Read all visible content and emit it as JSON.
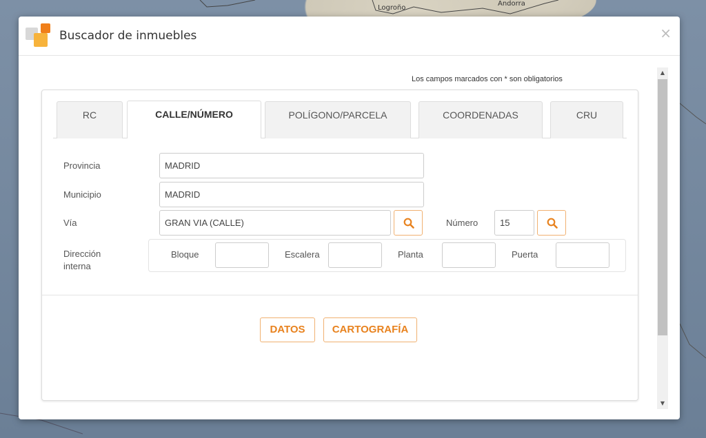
{
  "map": {
    "labels": [
      "Logroño",
      "Andorra"
    ]
  },
  "dialog": {
    "title": "Buscador de inmuebles",
    "close_label": "×"
  },
  "required_note": "Los campos marcados con * son obligatorios",
  "tabs": [
    {
      "label": "RC",
      "active": false
    },
    {
      "label": "CALLE/NÚMERO",
      "active": true
    },
    {
      "label": "POLÍGONO/PARCELA",
      "active": false
    },
    {
      "label": "COORDENADAS",
      "active": false
    },
    {
      "label": "CRU",
      "active": false
    }
  ],
  "form": {
    "provincia": {
      "label": "Provincia",
      "value": "MADRID"
    },
    "municipio": {
      "label": "Municipio",
      "value": "MADRID"
    },
    "via": {
      "label": "Vía",
      "value": "GRAN VIA (CALLE)"
    },
    "numero": {
      "label": "Número",
      "value": "15"
    },
    "direccion_interna": {
      "label_line1": "Dirección",
      "label_line2": "interna",
      "bloque": {
        "label": "Bloque",
        "value": ""
      },
      "escalera": {
        "label": "Escalera",
        "value": ""
      },
      "planta": {
        "label": "Planta",
        "value": ""
      },
      "puerta": {
        "label": "Puerta",
        "value": ""
      }
    }
  },
  "actions": {
    "datos": "DATOS",
    "cartografia": "CARTOGRAFÍA"
  },
  "colors": {
    "accent": "#e8821e",
    "accent_border": "#f0b070",
    "logo_orange": "#f07f1a",
    "logo_yellow": "#f7b33c"
  },
  "icons": {
    "search": "search-icon",
    "close": "close-icon",
    "scroll_up": "chevron-up-icon",
    "scroll_down": "chevron-down-icon"
  }
}
